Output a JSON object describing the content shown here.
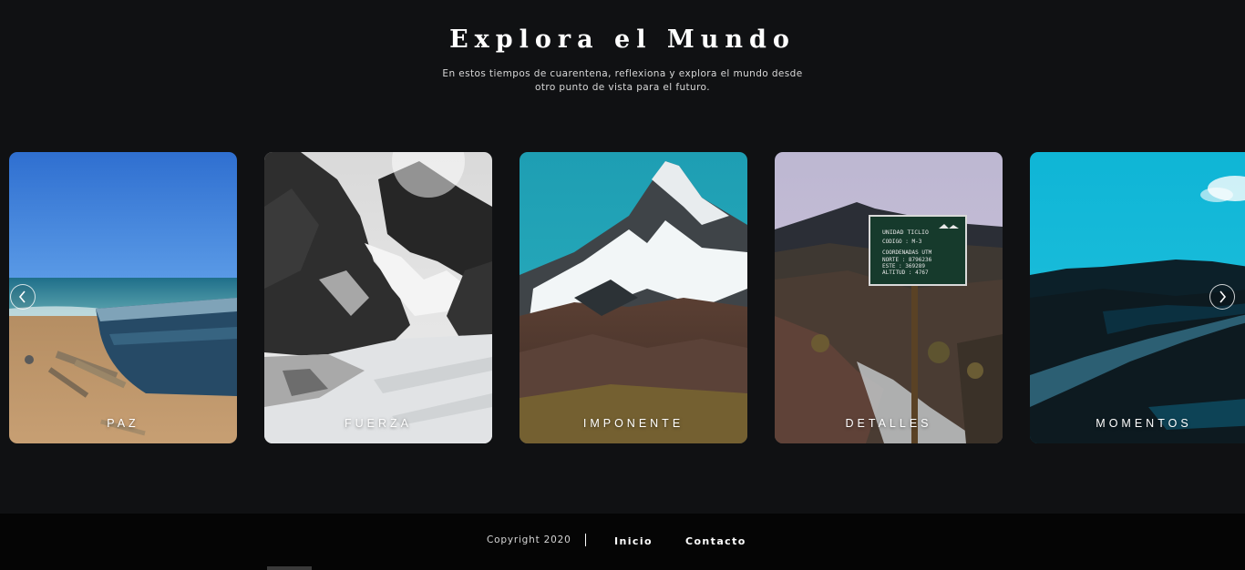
{
  "hero": {
    "title": "Explora el Mundo",
    "subtitle": "En estos tiempos de cuarentena, reflexiona y explora el mundo desde otro punto de vista para el futuro."
  },
  "carousel": {
    "prev_icon": "chevron-left-icon",
    "next_icon": "chevron-right-icon",
    "cards": [
      {
        "label": "PAZ",
        "image": "beach-boat-photo"
      },
      {
        "label": "FUERZA",
        "image": "snowy-rocks-photo"
      },
      {
        "label": "IMPONENTE",
        "image": "mountain-peak-photo"
      },
      {
        "label": "DETALLES",
        "image": "ticlio-sign-photo"
      },
      {
        "label": "MOMENTOS",
        "image": "winding-road-photo"
      }
    ]
  },
  "sign": {
    "line1": "UNIDAD TICLIO",
    "line2": "CODIGO : M-3",
    "line3": "COORDENADAS UTM",
    "line4": "NORTE : 8796236",
    "line5": "ESTE : 369289",
    "line6": "ALTITUD : 4767"
  },
  "footer": {
    "copyright": "Copyright 2020",
    "links": [
      "Inicio",
      "Contacto"
    ]
  },
  "colors": {
    "background": "#101113",
    "footer_background": "#050505",
    "text": "#ffffff"
  }
}
